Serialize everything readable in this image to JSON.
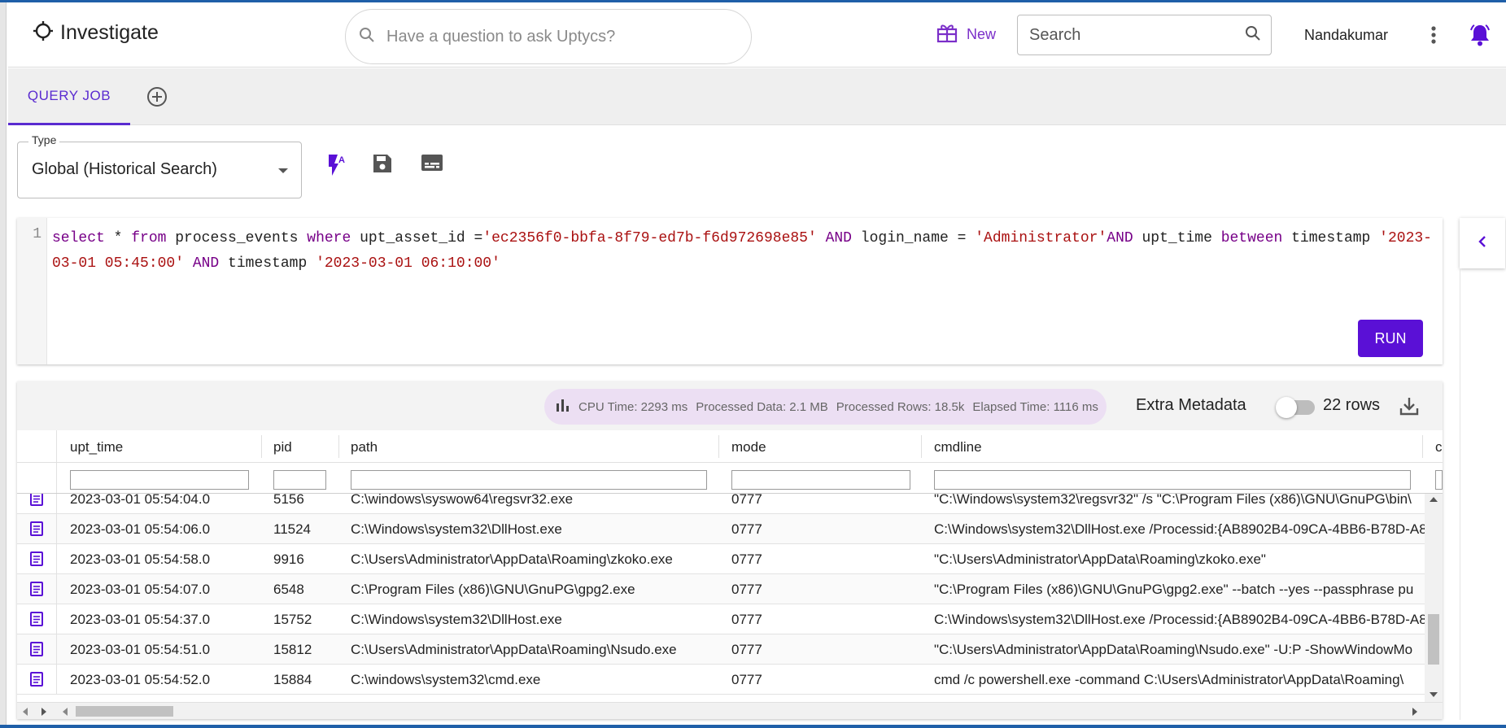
{
  "header": {
    "app_title": "Investigate",
    "ask_placeholder": "Have a question to ask Uptycs?",
    "new_label": "New",
    "search_placeholder": "Search",
    "user_name": "Nandakumar"
  },
  "tabs": [
    {
      "label": "QUERY JOB",
      "active": true
    }
  ],
  "query_form": {
    "type_label": "Type",
    "type_value": "Global (Historical Search)",
    "line_number": "1",
    "run_label": "RUN"
  },
  "query": {
    "line1": [
      {
        "t": "kw",
        "v": "select"
      },
      {
        "t": "op",
        "v": " * "
      },
      {
        "t": "kw",
        "v": "from"
      },
      {
        "t": "id",
        "v": " process_events "
      },
      {
        "t": "kw",
        "v": "where"
      },
      {
        "t": "id",
        "v": " upt_asset_id ="
      },
      {
        "t": "str",
        "v": "'ec2356f0-bbfa-8f79-ed7b-f6d972698e85'"
      },
      {
        "t": "kw",
        "v": " AND "
      },
      {
        "t": "id",
        "v": "login_name = "
      },
      {
        "t": "str",
        "v": "'Administrator'"
      },
      {
        "t": "kw",
        "v": "AND "
      },
      {
        "t": "id",
        "v": "upt_time "
      },
      {
        "t": "kw",
        "v": "between"
      },
      {
        "t": "id",
        "v": " timestamp"
      }
    ],
    "line2": [
      {
        "t": "str",
        "v": "'2023-03-01 05:45:00'"
      },
      {
        "t": "kw",
        "v": " AND "
      },
      {
        "t": "id",
        "v": "timestamp "
      },
      {
        "t": "str",
        "v": "'2023-03-01 06:10:00'"
      }
    ]
  },
  "stats": {
    "cpu_time": "CPU Time: 2293 ms",
    "processed_data": "Processed Data: 2.1 MB",
    "processed_rows": "Processed Rows: 18.5k",
    "elapsed_time": "Elapsed Time: 1116 ms"
  },
  "results": {
    "extra_metadata_label": "Extra Metadata",
    "extra_metadata_on": false,
    "rows_count": "22 rows",
    "columns": [
      "upt_time",
      "pid",
      "path",
      "mode",
      "cmdline",
      "c"
    ],
    "rows": [
      [
        "2023-03-01 05:54:04.0",
        "5156",
        "C:\\windows\\syswow64\\regsvr32.exe",
        "0777",
        "\"C:\\Windows\\system32\\regsvr32\" /s \"C:\\Program Files (x86)\\GNU\\GnuPG\\bin\\"
      ],
      [
        "2023-03-01 05:54:06.0",
        "11524",
        "C:\\Windows\\system32\\DllHost.exe",
        "0777",
        "C:\\Windows\\system32\\DllHost.exe /Processid:{AB8902B4-09CA-4BB6-B78D-A8"
      ],
      [
        "2023-03-01 05:54:58.0",
        "9916",
        "C:\\Users\\Administrator\\AppData\\Roaming\\zkoko.exe",
        "0777",
        "\"C:\\Users\\Administrator\\AppData\\Roaming\\zkoko.exe\""
      ],
      [
        "2023-03-01 05:54:07.0",
        "6548",
        "C:\\Program Files (x86)\\GNU\\GnuPG\\gpg2.exe",
        "0777",
        "\"C:\\Program Files (x86)\\GNU\\GnuPG\\gpg2.exe\" --batch --yes --passphrase pu"
      ],
      [
        "2023-03-01 05:54:37.0",
        "15752",
        "C:\\Windows\\system32\\DllHost.exe",
        "0777",
        "C:\\Windows\\system32\\DllHost.exe /Processid:{AB8902B4-09CA-4BB6-B78D-A8"
      ],
      [
        "2023-03-01 05:54:51.0",
        "15812",
        "C:\\Users\\Administrator\\AppData\\Roaming\\Nsudo.exe",
        "0777",
        "\"C:\\Users\\Administrator\\AppData\\Roaming\\Nsudo.exe\" -U:P -ShowWindowMo"
      ],
      [
        "2023-03-01 05:54:52.0",
        "15884",
        "C:\\windows\\system32\\cmd.exe",
        "0777",
        "cmd /c powershell.exe -command C:\\Users\\Administrator\\AppData\\Roaming\\"
      ]
    ]
  },
  "colors": {
    "accent": "#5a10d6",
    "tab_active": "#5a2bd0",
    "new_purple": "#7b2fc9",
    "stats_bg": "#ecdff3",
    "keyword": "#770088",
    "string": "#aa1111"
  },
  "icons": {
    "brand": "crosshair-icon",
    "ask": "search-icon",
    "new": "gift-icon",
    "search": "search-icon",
    "menu": "kebab-icon",
    "notifications": "bell-icon",
    "add_tab": "plus-circle-icon",
    "tools": [
      "flash-auto-icon",
      "save-icon",
      "subtitles-icon"
    ],
    "stats": "bar-chart-icon",
    "download": "download-icon",
    "row": "document-icon",
    "collapse": "chevron-left-icon"
  }
}
